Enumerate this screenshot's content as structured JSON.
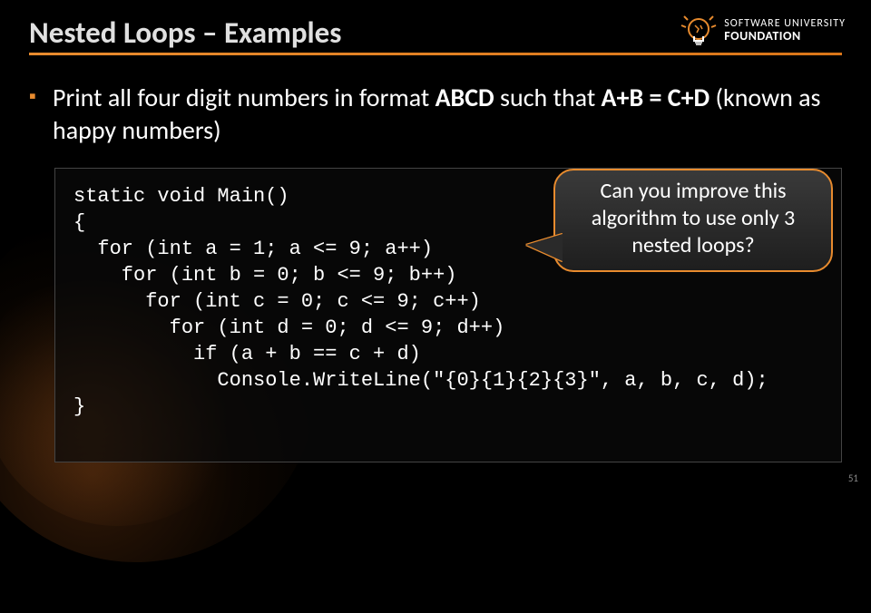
{
  "title": "Nested Loops – Examples",
  "logo": {
    "line1": "SOFTWARE UNIVERSITY",
    "line2": "FOUNDATION"
  },
  "bullet": {
    "pre": "Print all four digit numbers in format ",
    "b1": "ABCD",
    "mid": " such that ",
    "b2": "A+B = C+D",
    "post": " (known as happy numbers)"
  },
  "code": {
    "l1": "static void Main()",
    "l2": "{",
    "l3": "  for (int a = 1; a <= 9; a++)",
    "l4": "    for (int b = 0; b <= 9; b++)",
    "l5": "      for (int c = 0; c <= 9; c++)",
    "l6": "        for (int d = 0; d <= 9; d++)",
    "l7": "          if (a + b == c + d)",
    "l8": "            Console.WriteLine(\"{0}{1}{2}{3}\", a, b, c, d);",
    "l9": "}"
  },
  "callout": "Can you improve this algorithm to use only 3 nested loops?",
  "page_number": "51"
}
